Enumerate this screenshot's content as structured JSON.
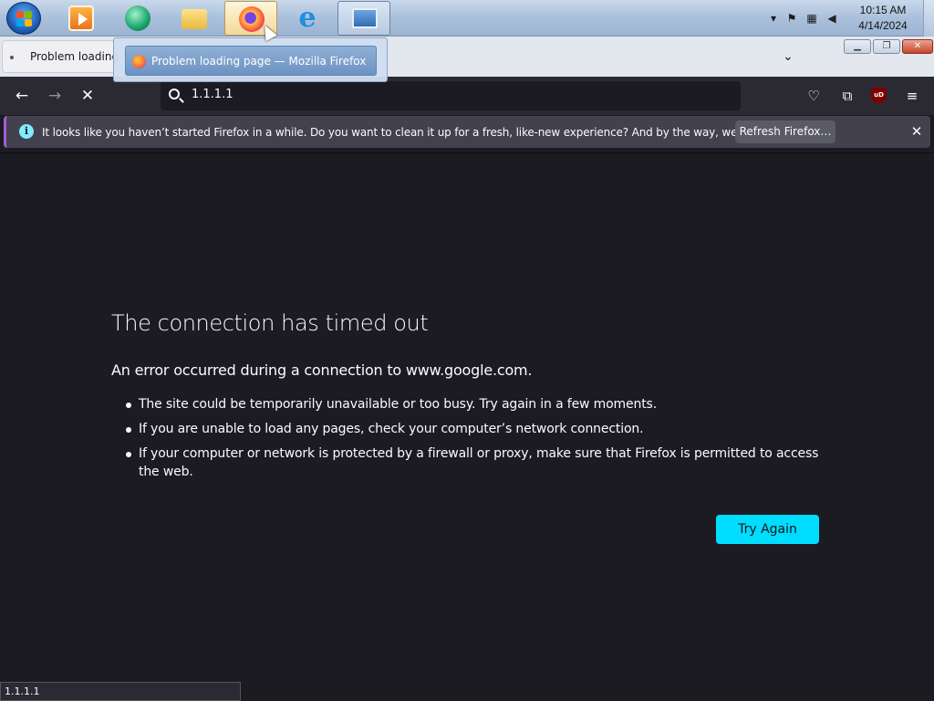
{
  "taskbar": {
    "apps": [
      {
        "name": "media-player"
      },
      {
        "name": "chat-app"
      },
      {
        "name": "file-explorer"
      },
      {
        "name": "firefox"
      },
      {
        "name": "internet-explorer"
      },
      {
        "name": "control-panel"
      }
    ],
    "clock": {
      "time": "10:15 AM",
      "date": "4/14/2024"
    }
  },
  "thumbnail_popup": {
    "title": "Problem loading page — Mozilla Firefox"
  },
  "tabs": [
    {
      "label": "Problem loading"
    }
  ],
  "navbar": {
    "url": "1.1.1.1",
    "ublock_badge": "uD"
  },
  "notification": {
    "message": "It looks like you haven’t started Firefox in a while. Do you want to clean it up for a fresh, like-new experience? And by the way, welcome back!",
    "refresh_label": "Refresh Firefox…"
  },
  "error": {
    "title": "The connection has timed out",
    "description": "An error occurred during a connection to www.google.com.",
    "bullets": [
      "The site could be temporarily unavailable or too busy. Try again in a few moments.",
      "If you are unable to load any pages, check your computer’s network connection.",
      "If your computer or network is protected by a firewall or proxy, make sure that Firefox is permitted to access the web."
    ],
    "try_again_label": "Try Again"
  },
  "status_bar": {
    "text": "1.1.1.1"
  },
  "colors": {
    "accent": "#00ddff",
    "page_bg": "#1c1b22",
    "toolbar_bg": "#2b2a33",
    "notice_bg": "#42414d"
  }
}
